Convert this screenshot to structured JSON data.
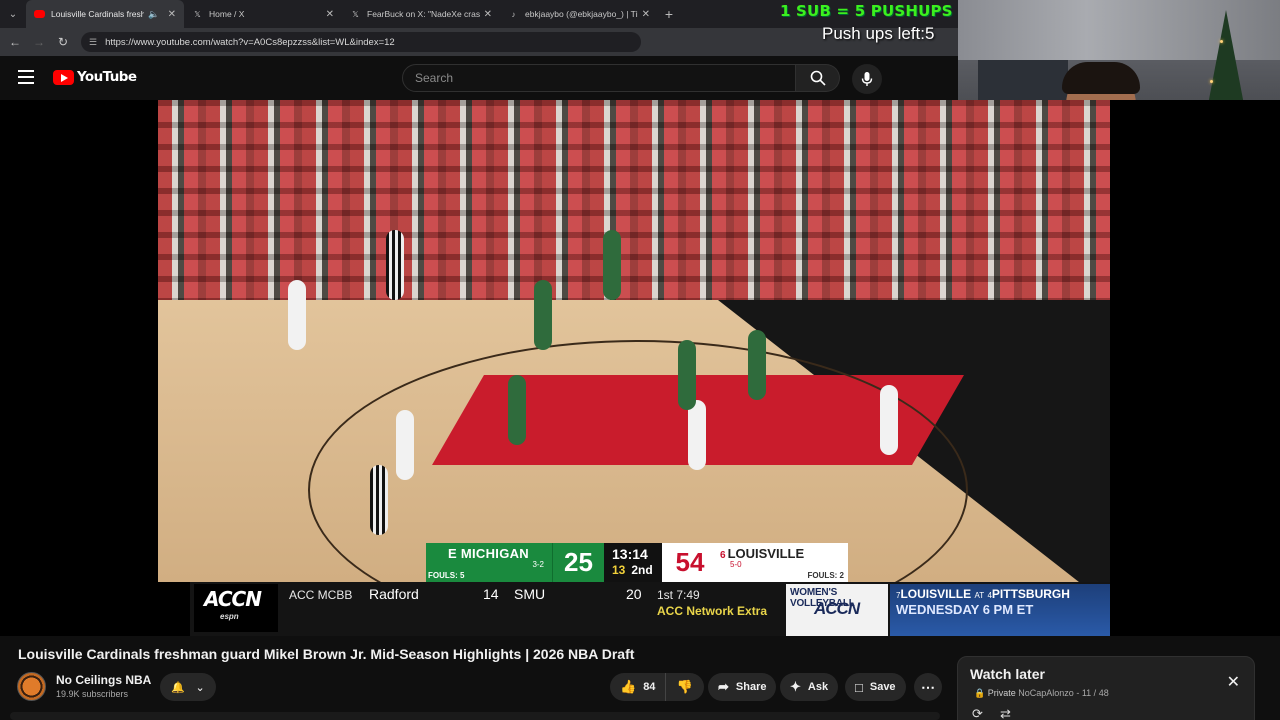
{
  "browser": {
    "tabs": [
      {
        "title": "Louisville Cardinals freshm",
        "icon": "youtube-icon",
        "audio": true,
        "active": true
      },
      {
        "title": "Home / X",
        "icon": "x-icon",
        "audio": false,
        "active": false
      },
      {
        "title": "FearBuck on X: \"NadeXe crashe",
        "icon": "x-icon",
        "audio": false,
        "active": false
      },
      {
        "title": "ebkjaaybo (@ebkjaaybo_) | Tik",
        "icon": "tiktok-icon",
        "audio": false,
        "active": false
      }
    ],
    "url": "https://www.youtube.com/watch?v=A0Cs8epzzss&list=WL&index=12"
  },
  "overlay": {
    "sub_banner": "1 SUB = 5 PUSHUPS",
    "pushups_left": "Push ups left:5",
    "banner_color": "#3cf01e"
  },
  "youtube": {
    "logo_text": "YouTube",
    "search_placeholder": "Search"
  },
  "scorebug": {
    "team1": {
      "name": "E MICHIGAN",
      "record": "3-2",
      "score": "25",
      "fouls": "FOULS: 5",
      "color": "#1a8a3e"
    },
    "clock": {
      "time": "13:14",
      "shot_clock": "13",
      "period": "2nd"
    },
    "team2": {
      "rank": "6",
      "name": "LOUISVILLE",
      "record": "5-0",
      "score": "54",
      "fouls": "FOULS: 2",
      "color": "#c8102e"
    }
  },
  "ticker": {
    "network_logo": "ACCN",
    "network_sub": "espn",
    "league": "ACC MCBB",
    "team_a": "Radford",
    "score_a": "14",
    "team_b": "SMU",
    "score_b": "20",
    "status": "1st 7:49",
    "channel": "ACC Network Extra",
    "promo_league": "WOMEN'S VOLLEYBALL",
    "promo_logo": "ACCN",
    "promo_matchup_rank": "7",
    "promo_matchup_home": "LOUISVILLE",
    "promo_matchup_at": "AT",
    "promo_matchup_rank2": "4",
    "promo_matchup_away": "PITTSBURGH",
    "promo_time": "WEDNESDAY 6 PM ET"
  },
  "video": {
    "title": "Louisville Cardinals freshman guard Mikel Brown Jr. Mid-Season Highlights | 2026 NBA Draft",
    "channel_name": "No Ceilings NBA",
    "subscribers": "19.9K subscribers",
    "likes": "84",
    "share_label": "Share",
    "ask_label": "Ask",
    "save_label": "Save"
  },
  "playlist": {
    "title": "Watch later",
    "privacy": "Private",
    "owner": "NoCapAlonzo",
    "position": "11 / 48"
  }
}
